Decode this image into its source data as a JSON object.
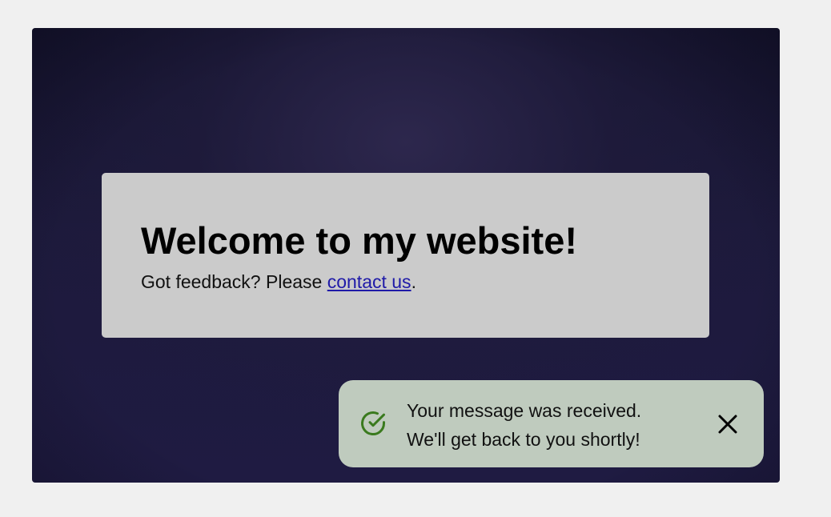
{
  "card": {
    "heading": "Welcome to my website!",
    "text_before_link": "Got feedback? Please ",
    "link_label": "contact us",
    "text_after_link": "."
  },
  "toast": {
    "line1": "Your message was received.",
    "line2": "We'll get back to you shortly!",
    "status_icon": "check-circle-icon",
    "close_icon": "close-icon"
  },
  "colors": {
    "page_background": "#f0f0f0",
    "stage_background": "#1f1b42",
    "card_background": "#cbcbcb",
    "toast_background": "#bfcbbe",
    "success_green": "#3a7a1e",
    "link": "#1f1aa8"
  }
}
